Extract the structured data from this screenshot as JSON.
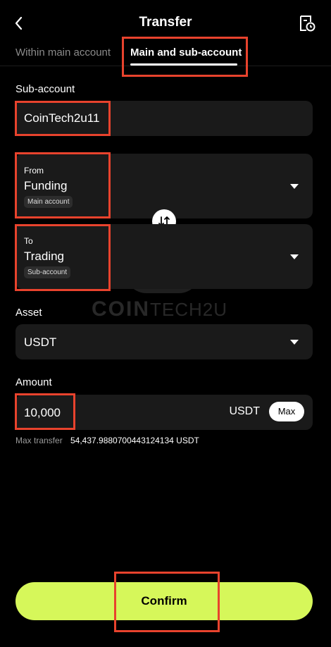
{
  "header": {
    "title": "Transfer"
  },
  "tabs": [
    {
      "label": "Within main account"
    },
    {
      "label": "Main and sub-account"
    }
  ],
  "sub_account": {
    "label": "Sub-account",
    "value": "CoinTech2u11"
  },
  "from": {
    "label": "From",
    "value": "Funding",
    "chip": "Main account"
  },
  "to": {
    "label": "To",
    "value": "Trading",
    "chip": "Sub-account"
  },
  "asset": {
    "label": "Asset",
    "value": "USDT"
  },
  "amount": {
    "label": "Amount",
    "value": "10,000",
    "unit": "USDT",
    "max_label": "Max"
  },
  "max_transfer": {
    "label": "Max transfer",
    "value": "54,437.9880700443124134 USDT"
  },
  "confirm_label": "Confirm",
  "watermark": {
    "text_bold": "COIN",
    "text_light": "TECH2U"
  },
  "colors": {
    "accent": "#d6f75a",
    "highlight": "#e8432d",
    "field_bg": "#1a1a1a"
  },
  "icons": {
    "back": "chevron-left-icon",
    "history": "document-clock-icon",
    "swap": "swap-arrows-icon",
    "dropdown": "caret-down-icon"
  }
}
